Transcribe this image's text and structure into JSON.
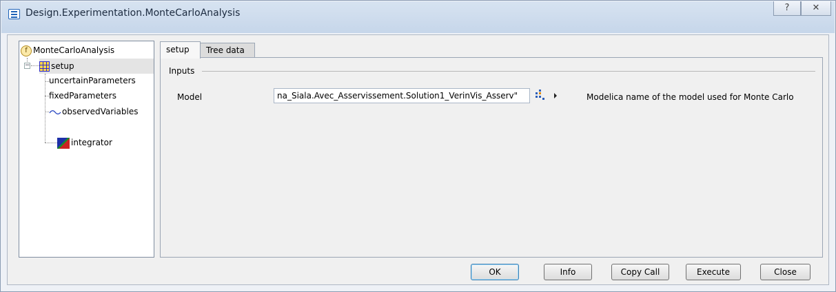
{
  "window": {
    "title": "Design.Experimentation.MonteCarloAnalysis",
    "help_glyph": "?",
    "close_glyph": "✕"
  },
  "tree": {
    "root": {
      "label": "MonteCarloAnalysis",
      "icon": "function-icon"
    },
    "setup": {
      "label": "setup",
      "icon": "grid-icon",
      "expander": "−"
    },
    "children": [
      {
        "label": "uncertainParameters"
      },
      {
        "label": "fixedParameters"
      },
      {
        "label": "observedVariables",
        "icon": "wave-icon"
      },
      {
        "label": "integrator",
        "icon": "integrator-icon"
      }
    ]
  },
  "tabs": [
    {
      "label": "setup",
      "active": true
    },
    {
      "label": "Tree data",
      "active": false
    }
  ],
  "panel": {
    "group_label": "Inputs",
    "model": {
      "label": "Model",
      "value": "na_Siala.Avec_Asservissement.Solution1_VerinVis_Asserv\"",
      "description": "Modelica name of the model used for Monte Carlo"
    }
  },
  "buttons": {
    "ok": "OK",
    "info": "Info",
    "copy_call": "Copy Call",
    "execute": "Execute",
    "close": "Close"
  },
  "colors": {
    "title_bar": "#c6d6ea",
    "selection": "#e4e4e4",
    "default_button_border": "#3c7fb1"
  }
}
